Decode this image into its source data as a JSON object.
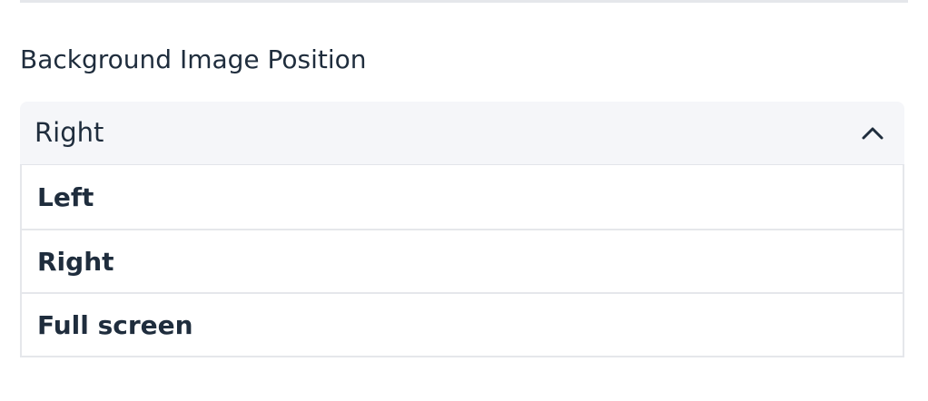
{
  "field": {
    "label": "Background Image Position",
    "selected_value": "Right",
    "options": [
      "Left",
      "Right",
      "Full screen"
    ]
  },
  "icons": {
    "toggle": "chevron-up-icon"
  },
  "colors": {
    "text": "#1f2d3d",
    "trigger_background": "#f5f6f9",
    "border": "#e5e7eb"
  }
}
